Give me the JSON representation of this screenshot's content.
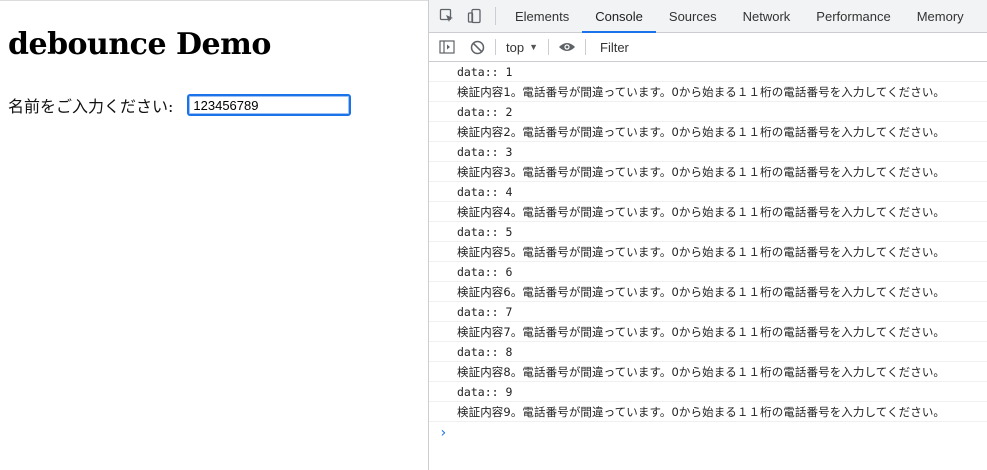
{
  "page": {
    "title": "debounce Demo",
    "label": "名前をご入力ください:",
    "input_value": "123456789"
  },
  "devtools": {
    "tabs": [
      "Elements",
      "Console",
      "Sources",
      "Network",
      "Performance",
      "Memory"
    ],
    "active_tab": "Console",
    "context": "top",
    "filter_placeholder": "Filter",
    "console_lines": [
      {
        "text": "data:: 1",
        "kind": "data"
      },
      {
        "text": "検証内容1。電話番号が間違っています。0から始まる１１桁の電話番号を入力してください。",
        "kind": "msg"
      },
      {
        "text": "data:: 2",
        "kind": "data"
      },
      {
        "text": "検証内容2。電話番号が間違っています。0から始まる１１桁の電話番号を入力してください。",
        "kind": "msg"
      },
      {
        "text": "data:: 3",
        "kind": "data"
      },
      {
        "text": "検証内容3。電話番号が間違っています。0から始まる１１桁の電話番号を入力してください。",
        "kind": "msg"
      },
      {
        "text": "data:: 4",
        "kind": "data"
      },
      {
        "text": "検証内容4。電話番号が間違っています。0から始まる１１桁の電話番号を入力してください。",
        "kind": "msg"
      },
      {
        "text": "data:: 5",
        "kind": "data"
      },
      {
        "text": "検証内容5。電話番号が間違っています。0から始まる１１桁の電話番号を入力してください。",
        "kind": "msg"
      },
      {
        "text": "data:: 6",
        "kind": "data"
      },
      {
        "text": "検証内容6。電話番号が間違っています。0から始まる１１桁の電話番号を入力してください。",
        "kind": "msg"
      },
      {
        "text": "data:: 7",
        "kind": "data"
      },
      {
        "text": "検証内容7。電話番号が間違っています。0から始まる１１桁の電話番号を入力してください。",
        "kind": "msg"
      },
      {
        "text": "data:: 8",
        "kind": "data"
      },
      {
        "text": "検証内容8。電話番号が間違っています。0から始まる１１桁の電話番号を入力してください。",
        "kind": "msg"
      },
      {
        "text": "data:: 9",
        "kind": "data"
      },
      {
        "text": "検証内容9。電話番号が間違っています。0から始まる１１桁の電話番号を入力してください。",
        "kind": "msg"
      }
    ],
    "prompt_glyph": "›"
  },
  "colors": {
    "accent": "#1a73e8",
    "chrome_bg": "#f1f3f4",
    "border": "#cbcdd1"
  },
  "icons": {
    "tabbar": [
      "inspect-element-icon",
      "device-toolbar-icon"
    ],
    "toolbar": [
      "sidebar-toggle-icon",
      "clear-console-icon",
      "live-expression-eye-icon"
    ]
  }
}
